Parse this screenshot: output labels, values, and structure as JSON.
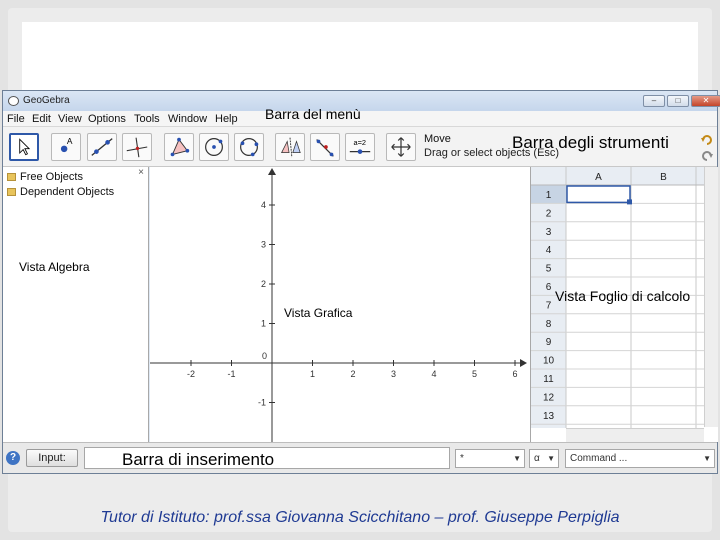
{
  "window": {
    "title": "GeoGebra",
    "buttons": {
      "minimize": "–",
      "maximize": "□",
      "close": "✕"
    }
  },
  "menu": [
    "File",
    "Edit",
    "View",
    "Options",
    "Tools",
    "Window",
    "Help"
  ],
  "toolbar": {
    "tools": [
      {
        "icon": "move-arrow-icon",
        "selected": true
      },
      {
        "icon": "point-icon"
      },
      {
        "icon": "line-icon"
      },
      {
        "icon": "perpendicular-line-icon"
      },
      {
        "icon": "polygon-icon"
      },
      {
        "icon": "circle-icon"
      },
      {
        "icon": "circle-through-points-icon"
      },
      {
        "icon": "reflect-icon"
      },
      {
        "icon": "angle-icon"
      },
      {
        "icon": "slider-icon"
      },
      {
        "icon": "move-graphics-icon"
      }
    ],
    "slider_label": "a=2",
    "active_tool_name": "Move",
    "active_tool_help": "Drag or select objects (Esc)"
  },
  "algebra": {
    "free_objects": "Free Objects",
    "dependent_objects": "Dependent Objects",
    "close": "×"
  },
  "graphics": {
    "x_ticks": [
      -2,
      -1,
      0,
      1,
      2,
      3,
      4,
      5,
      6
    ],
    "y_ticks": [
      -1,
      0,
      1,
      2,
      3,
      4
    ]
  },
  "spreadsheet": {
    "columns": [
      "A",
      "B"
    ],
    "rows": [
      "1",
      "2",
      "3",
      "4",
      "5",
      "6",
      "7",
      "8",
      "9",
      "10",
      "11",
      "12",
      "13"
    ]
  },
  "inputbar": {
    "help": "?",
    "input_label": "Input:",
    "symbol_combo": "*",
    "greek_combo": "α",
    "command_combo": "Command ..."
  },
  "annotations": {
    "menu_bar": "Barra del menù",
    "tool_bar": "Barra degli strumenti",
    "algebra_view": "Vista Algebra",
    "graphics_view": "Vista Grafica",
    "spreadsheet_view": "Vista Foglio di calcolo",
    "input_bar": "Barra di inserimento"
  },
  "footer": "Tutor di Istituto: prof.ssa Giovanna Scicchitano – prof. Giuseppe Perpiglia"
}
